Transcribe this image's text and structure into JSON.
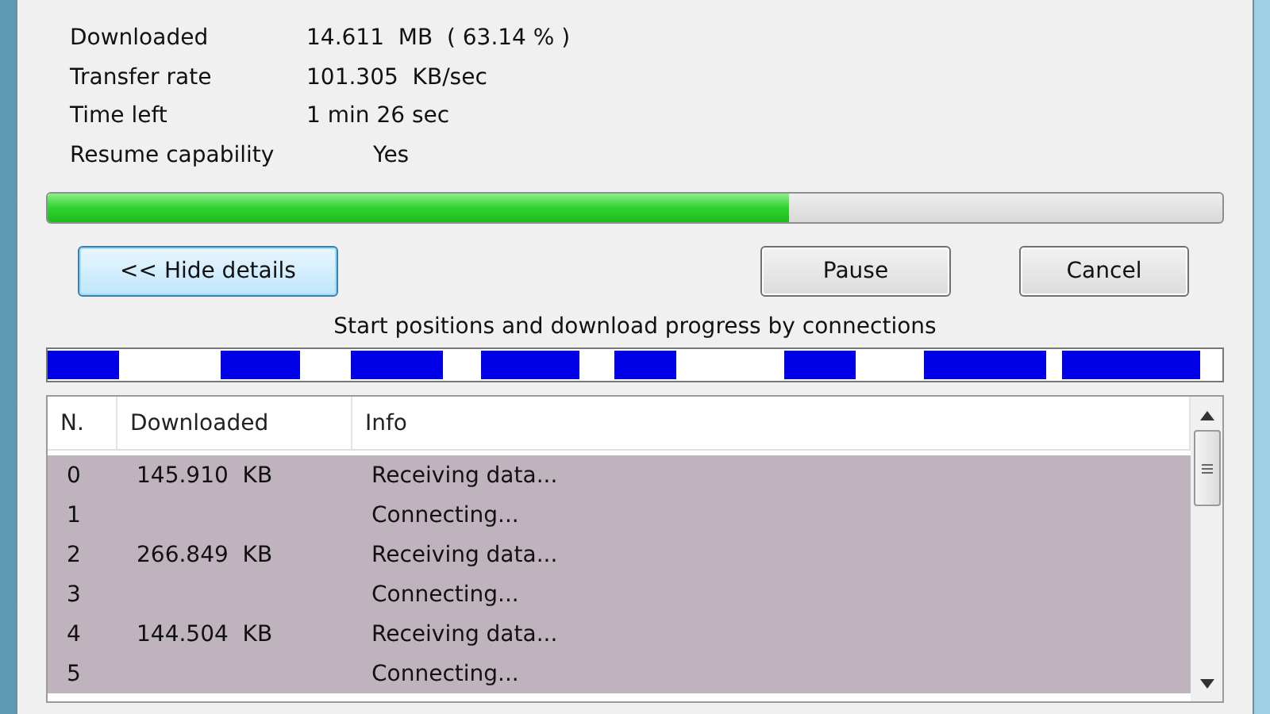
{
  "details": [
    {
      "label": "Downloaded",
      "value": "14.611  MB  ( 63.14 % )"
    },
    {
      "label": "Transfer rate",
      "value": "101.305  KB/sec"
    },
    {
      "label": "Time left",
      "value": "1 min 26 sec"
    },
    {
      "label": "Resume capability",
      "value": "Yes",
      "indent": true
    }
  ],
  "progress": {
    "level": 0.6314
  },
  "buttons": [
    {
      "label": "<< Hide details",
      "focused": true
    },
    {
      "label": "Pause",
      "focused": false
    },
    {
      "label": "Cancel",
      "focused": false
    }
  ],
  "connections_caption": "Start positions and download progress by connections",
  "table": {
    "columns": [
      "N.",
      "Downloaded",
      "Info"
    ],
    "rows": [
      {
        "n": "0",
        "downloaded": "145.910  KB",
        "info": "Receiving data...",
        "selected": true
      },
      {
        "n": "1",
        "downloaded": "",
        "info": "Connecting...",
        "selected": true
      },
      {
        "n": "2",
        "downloaded": "266.849  KB",
        "info": "Receiving data...",
        "selected": true
      },
      {
        "n": "3",
        "downloaded": "",
        "info": "Connecting...",
        "selected": true
      },
      {
        "n": "4",
        "downloaded": "144.504  KB",
        "info": "Receiving data...",
        "selected": true
      },
      {
        "n": "5",
        "downloaded": "",
        "info": "Connecting...",
        "selected": true
      }
    ]
  }
}
